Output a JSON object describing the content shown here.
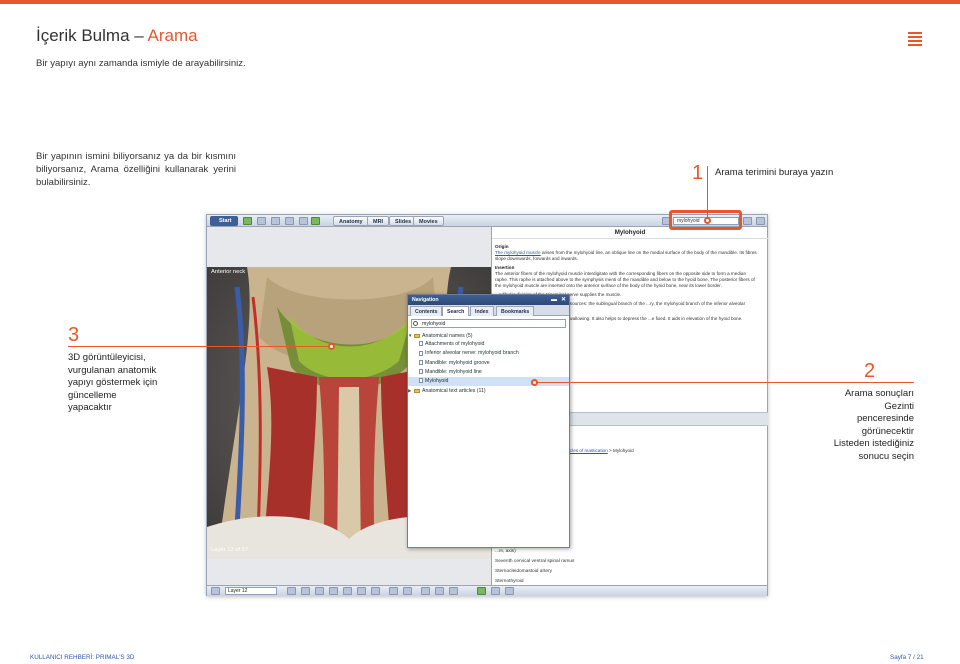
{
  "header": {
    "title_main": "İçerik Bulma – ",
    "title_accent": "Arama",
    "subtitle": "Bir yapıyı aynı zamanda ismiyle de arayabilirsiniz.",
    "accent_color": "#e8572a",
    "menu_icon": "hamburger-icon"
  },
  "intro": "Bir yapının ismini biliyorsanız ya da bir kısmını biliyorsanız, Arama özelliğini kullanarak yerini bulabilirsiniz.",
  "callouts": {
    "c1": {
      "num": "1",
      "text": "Arama terimini buraya yazın"
    },
    "c2": {
      "num": "2",
      "text_lines": [
        "Arama sonuçları",
        "Gezinti",
        "penceresinde",
        "görünecektir",
        "Listeden istediğiniz",
        "sonucu seçin"
      ]
    },
    "c3": {
      "num": "3",
      "text_lines": [
        "3D görüntüleyicisi,",
        "vurgulanan anatomik",
        "yapıyı göstermek için",
        "güncelleme",
        "yapacaktır"
      ]
    }
  },
  "app": {
    "start_label": "Start",
    "tabs": [
      "Anatomy",
      "MRI",
      "Slides",
      "Movies"
    ],
    "search_value": "mylohyoid",
    "viewer_label": "Anterior neck",
    "layer_label": "Layer 12 of 17",
    "layer_select": "Layer 12",
    "content": {
      "title": "Mylohyoid",
      "origin_h": "Origin",
      "origin_link": "The mylohyoid muscle",
      "origin_text": " arises from the mylohyoid line, an oblique line on the medial surface of the body of the mandible. Its fibres slope downwards, forwards and inwards.",
      "insertion_h": "Insertion",
      "insertion_text": "The anterior fibers of the mylohyoid muscle interdigitate with the corresponding fibers on the opposite side to form a median raphe. This raphe is attached above to the symphysis menti of the mandible and below to the hyoid bone. The posterior fibers of the mylohyoid muscle are inserted onto the anterior surface of the body of the hyoid bone, near its lower border.",
      "nerve_text": "...ndibular division of the trigeminal nerve supplies the muscle.",
      "blood_text": "...ts arterial supply from a number of sources: the sublingual branch of the ...ry, the mylohyoid branch of the inferior alveolar artery, and the submental",
      "action_text": "...e mouth during the first stages of swallowing. It also helps to depress the ...e fixed. It aids in elevation of the hyoid bone.",
      "crumb_plain": "...",
      "crumb_link": "uscles of the head and neck > Muscles of mastication",
      "crumb_tail": " > Mylohyoid",
      "list": [
        "...r ramus: lateral branch",
        "...l ramus",
        "...m, axis)",
        "Seventh cervical ventral spinal ramus",
        "Sternocleidomastoid artery",
        "Sternothyroid"
      ]
    },
    "nav": {
      "title": "Navigation",
      "tabs": [
        "Contents",
        "Search",
        "Index",
        "Bookmarks"
      ],
      "active_tab": "Search",
      "search_value": "mylohyoid",
      "tree": [
        {
          "label": "Anatomical names (5)",
          "type": "folder",
          "indent": 0
        },
        {
          "label": "Attachments of mylohyoid",
          "type": "doc",
          "indent": 1
        },
        {
          "label": "Inferior alveolar nerve: mylohyoid branch",
          "type": "doc",
          "indent": 1
        },
        {
          "label": "Mandible: mylohyoid groove",
          "type": "doc",
          "indent": 1
        },
        {
          "label": "Mandible: mylohyoid line",
          "type": "doc",
          "indent": 1
        },
        {
          "label": "Mylohyoid",
          "type": "doc",
          "indent": 1,
          "selected": true
        },
        {
          "label": "Anatomical text articles (11)",
          "type": "folder",
          "indent": 0
        }
      ]
    }
  },
  "footer": {
    "left": "KULLANICI REHBERİ: PRIMAL'S 3D",
    "right": "Sayfa 7 / 21"
  }
}
